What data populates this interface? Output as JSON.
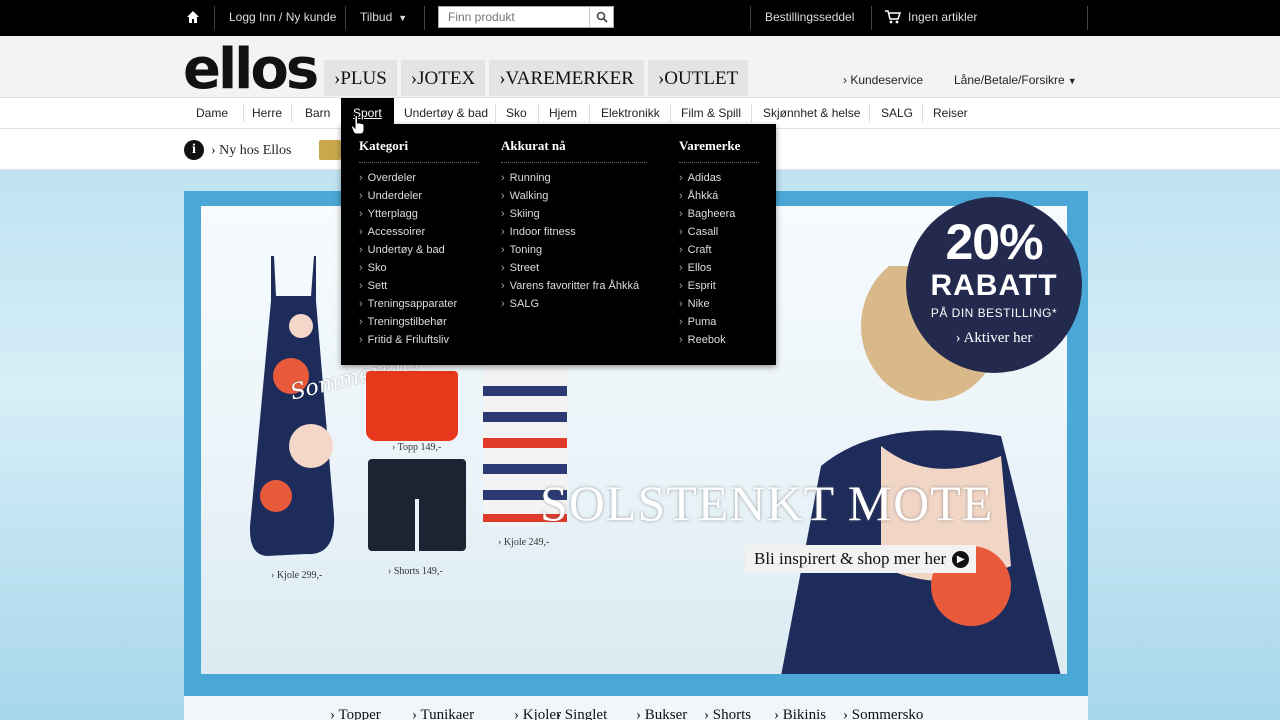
{
  "topbar": {
    "login": "Logg Inn / Ny kunde",
    "offers": "Tilbud",
    "search_placeholder": "Finn produkt",
    "order_form": "Bestillingsseddel",
    "cart": "Ingen artikler"
  },
  "header": {
    "logo": "ellos",
    "brand_tabs": [
      "›PLUS",
      "›JOTEX",
      "›VAREMERKER",
      "›OUTLET"
    ],
    "customer_service": "› Kundeservice",
    "payment": "Låne/Betale/Forsikre"
  },
  "categories": [
    "Dame",
    "Herre",
    "Barn",
    "Sport",
    "Undertøy & bad",
    "Sko",
    "Hjem",
    "Elektronikk",
    "Film & Spill",
    "Skjønnhet & helse",
    "SALG",
    "Reiser"
  ],
  "info": {
    "text": "› Ny hos Ellos"
  },
  "mega_menu": {
    "col1": {
      "title": "Kategori",
      "items": [
        "Overdeler",
        "Underdeler",
        "Ytterplagg",
        "Accessoirer",
        "Undertøy & bad",
        "Sko",
        "Sett",
        "Treningsapparater",
        "Treningstilbehør",
        "Fritid & Friluftsliv"
      ]
    },
    "col2": {
      "title": "Akkurat nå",
      "items": [
        "Running",
        "Walking",
        "Skiing",
        "Indoor fitness",
        "Toning",
        "Street",
        "Varens favoritter fra Åhkká",
        "SALG"
      ]
    },
    "col3": {
      "title": "Varemerke",
      "items": [
        "Adidas",
        "Åhkká",
        "Bagheera",
        "Casall",
        "Craft",
        "Ellos",
        "Esprit",
        "Nike",
        "Puma",
        "Reebok"
      ]
    }
  },
  "hero": {
    "script_text": "Sommerens herlige favoritter",
    "headline": "SOLSTENKT MOTE",
    "cta": "Bli inspirert & shop mer her",
    "products": {
      "dress1": "› Kjole 299,-",
      "top": "› Topp 149,-",
      "shorts": "› Shorts 149,-",
      "dress2": "› Kjole 249,-"
    },
    "badge": {
      "percent": "20%",
      "rabatt": "RABATT",
      "sub": "PÅ DIN BESTILLING*",
      "action": "› Aktiver her"
    }
  },
  "bottom_links": [
    "› Topper",
    "› Tunikaer",
    "› Kjoler",
    "› Singlet",
    "› Bukser",
    "› Shorts",
    "› Bikinis",
    "› Sommersko"
  ],
  "colors": {
    "topbar": "#000000",
    "hero_frame": "#4aa7d6",
    "badge": "#232a4e",
    "menu_bg": "#000000"
  }
}
